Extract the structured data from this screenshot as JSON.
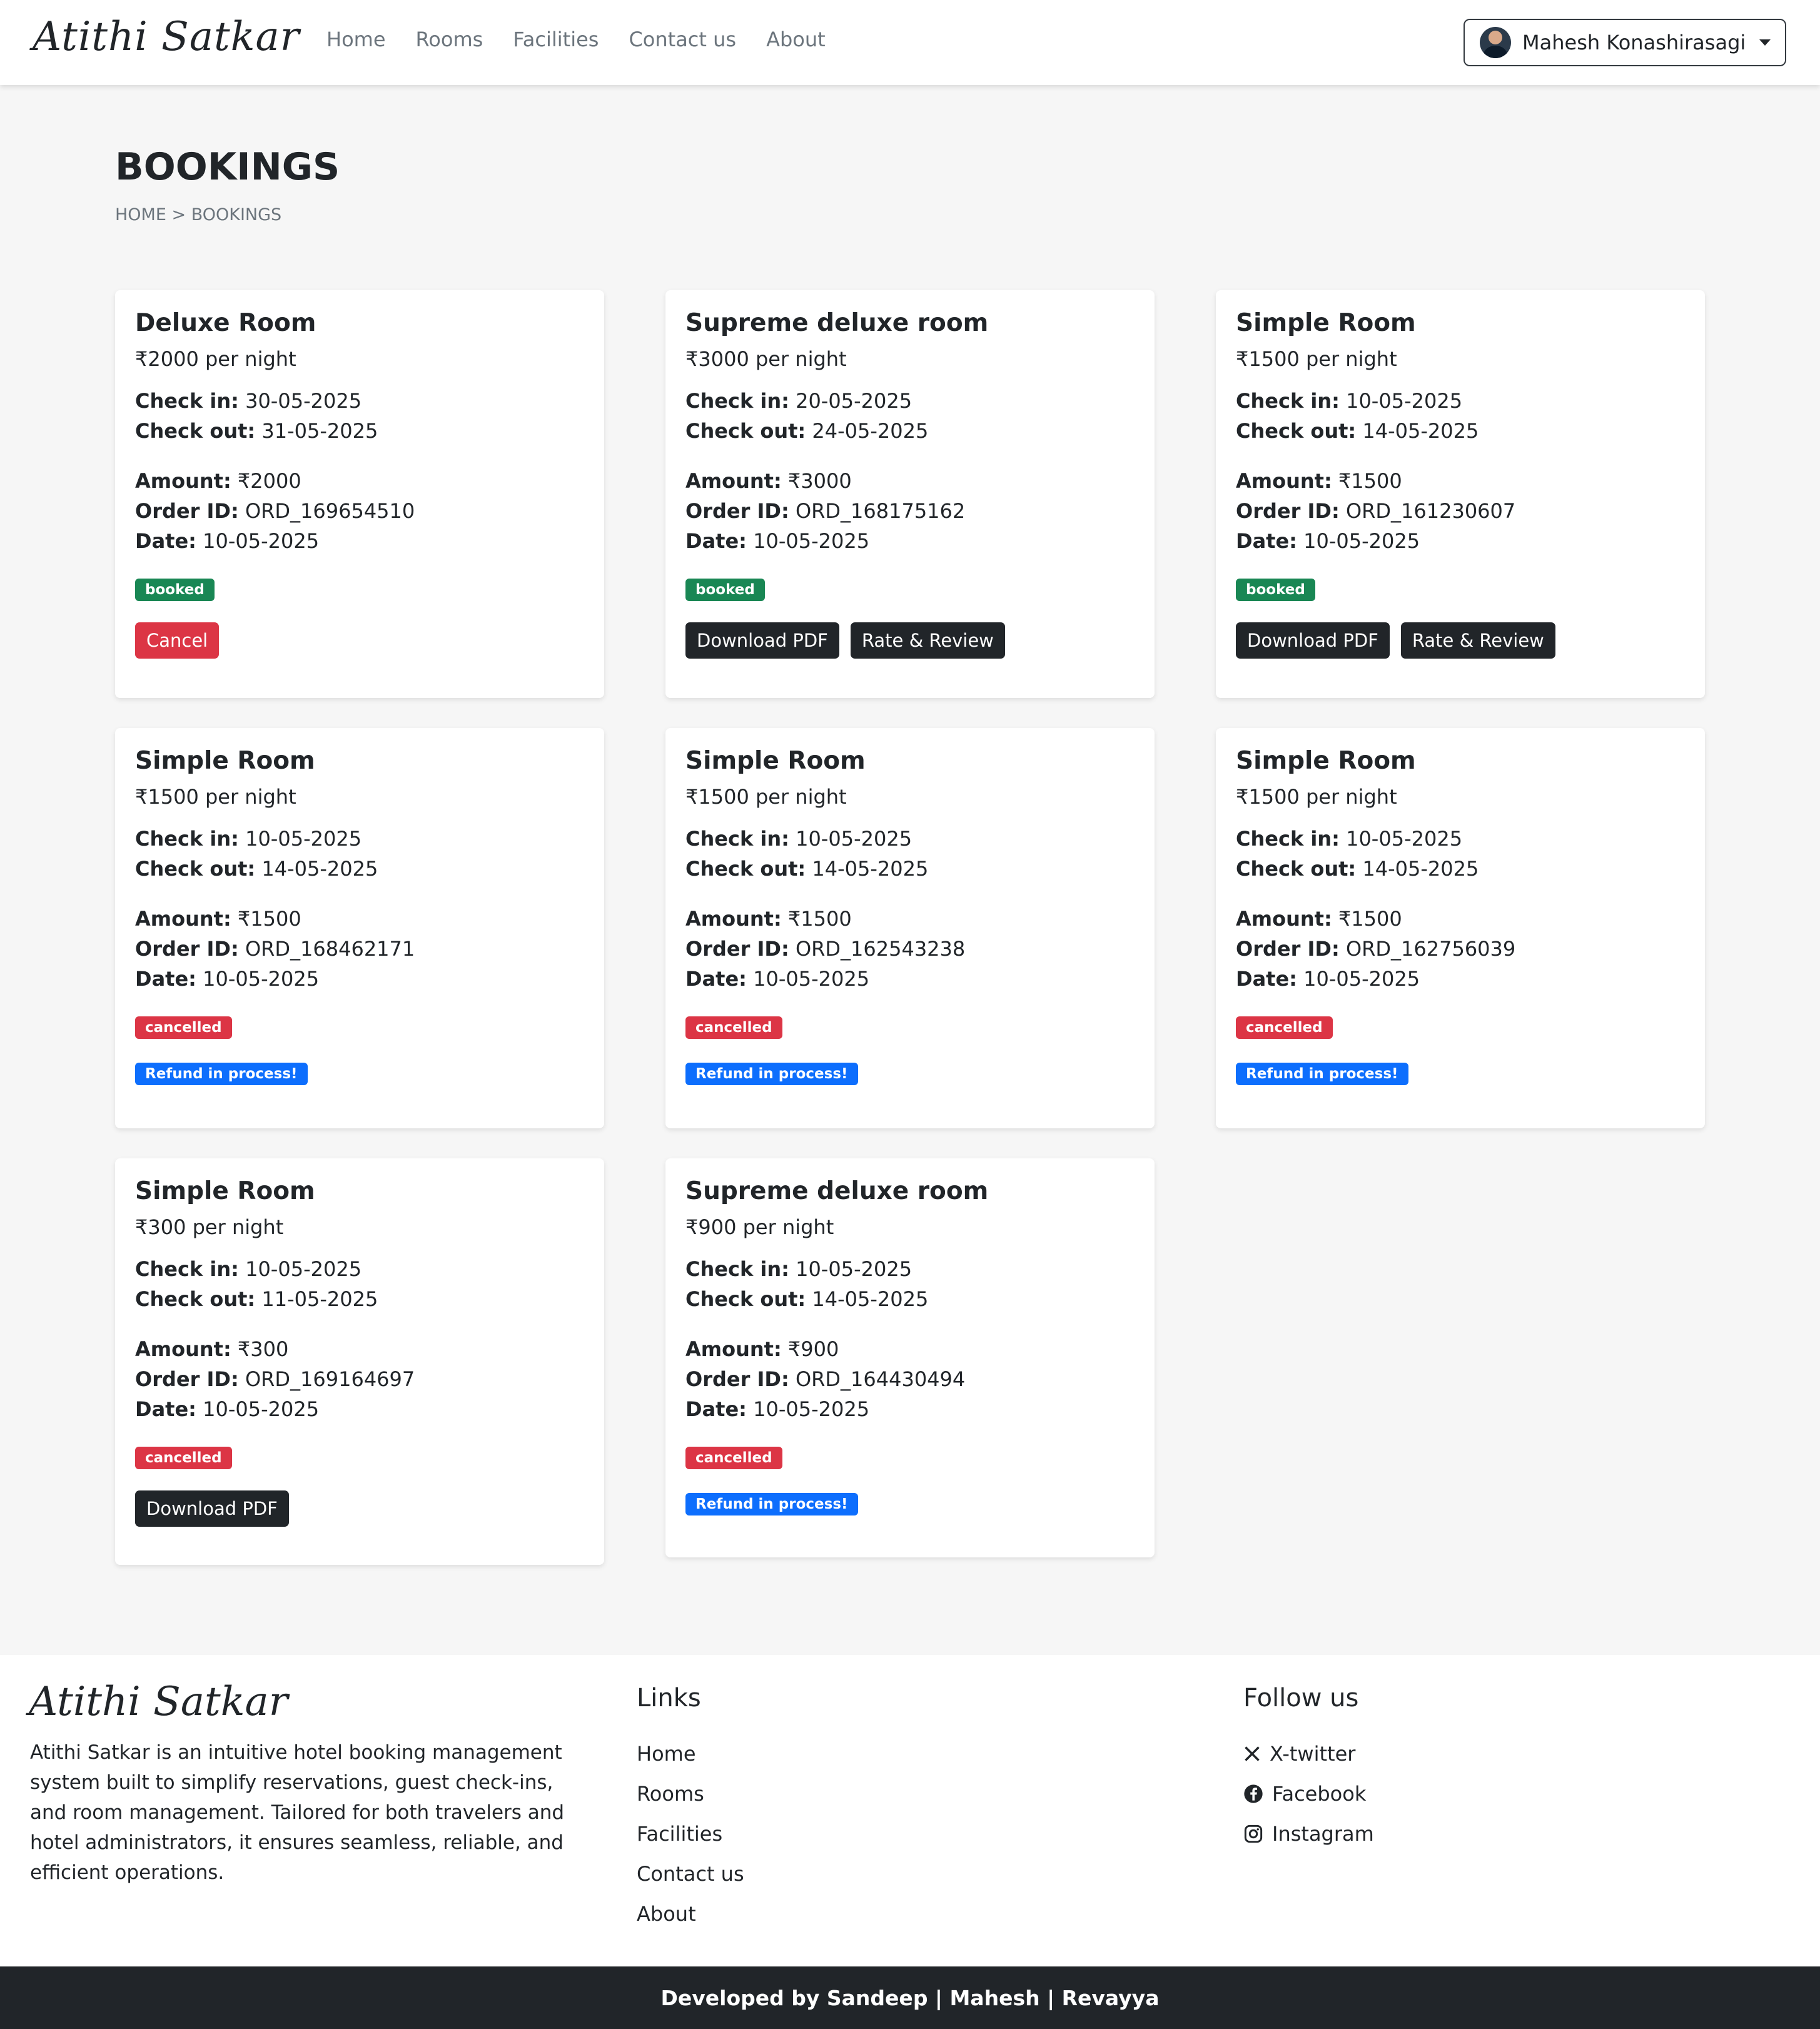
{
  "navbar": {
    "brand": "Atithi Satkar",
    "links": [
      "Home",
      "Rooms",
      "Facilities",
      "Contact us",
      "About"
    ],
    "user": "Mahesh Konashirasagi"
  },
  "header": {
    "title": "BOOKINGS",
    "breadcrumb": "HOME > BOOKINGS"
  },
  "labels": {
    "check_in": "Check in:",
    "check_out": "Check out:",
    "amount": "Amount:",
    "order_id": "Order ID:",
    "date": "Date:"
  },
  "bookings": [
    {
      "room": "Deluxe Room",
      "price": "₹2000 per night",
      "check_in": "30-05-2025",
      "check_out": "31-05-2025",
      "amount": "₹2000",
      "order_id": "ORD_169654510",
      "date": "10-05-2025",
      "status": "booked",
      "actions": [
        "Cancel"
      ]
    },
    {
      "room": "Supreme deluxe room",
      "price": "₹3000 per night",
      "check_in": "20-05-2025",
      "check_out": "24-05-2025",
      "amount": "₹3000",
      "order_id": "ORD_168175162",
      "date": "10-05-2025",
      "status": "booked",
      "actions": [
        "Download PDF",
        "Rate & Review"
      ]
    },
    {
      "room": "Simple Room",
      "price": "₹1500 per night",
      "check_in": "10-05-2025",
      "check_out": "14-05-2025",
      "amount": "₹1500",
      "order_id": "ORD_161230607",
      "date": "10-05-2025",
      "status": "booked",
      "actions": [
        "Download PDF",
        "Rate & Review"
      ]
    },
    {
      "room": "Simple Room",
      "price": "₹1500 per night",
      "check_in": "10-05-2025",
      "check_out": "14-05-2025",
      "amount": "₹1500",
      "order_id": "ORD_168462171",
      "date": "10-05-2025",
      "status": "cancelled",
      "refund": "Refund in process!"
    },
    {
      "room": "Simple Room",
      "price": "₹1500 per night",
      "check_in": "10-05-2025",
      "check_out": "14-05-2025",
      "amount": "₹1500",
      "order_id": "ORD_162543238",
      "date": "10-05-2025",
      "status": "cancelled",
      "refund": "Refund in process!"
    },
    {
      "room": "Simple Room",
      "price": "₹1500 per night",
      "check_in": "10-05-2025",
      "check_out": "14-05-2025",
      "amount": "₹1500",
      "order_id": "ORD_162756039",
      "date": "10-05-2025",
      "status": "cancelled",
      "refund": "Refund in process!"
    },
    {
      "room": "Simple Room",
      "price": "₹300 per night",
      "check_in": "10-05-2025",
      "check_out": "11-05-2025",
      "amount": "₹300",
      "order_id": "ORD_169164697",
      "date": "10-05-2025",
      "status": "cancelled",
      "actions": [
        "Download PDF"
      ]
    },
    {
      "room": "Supreme deluxe room",
      "price": "₹900 per night",
      "check_in": "10-05-2025",
      "check_out": "14-05-2025",
      "amount": "₹900",
      "order_id": "ORD_164430494",
      "date": "10-05-2025",
      "status": "cancelled",
      "refund": "Refund in process!"
    }
  ],
  "footer": {
    "brand": "Atithi Satkar",
    "description": "Atithi Satkar is an intuitive hotel booking management system built to simplify reservations, guest check-ins, and room management. Tailored for both travelers and hotel administrators, it ensures seamless, reliable, and efficient operations.",
    "links_heading": "Links",
    "links": [
      "Home",
      "Rooms",
      "Facilities",
      "Contact us",
      "About"
    ],
    "follow_heading": "Follow us",
    "social": [
      {
        "label": "X-twitter",
        "icon": "x-twitter-icon"
      },
      {
        "label": "Facebook",
        "icon": "facebook-icon"
      },
      {
        "label": "Instagram",
        "icon": "instagram-icon"
      }
    ],
    "credits": "Developed by Sandeep | Mahesh | Revayya"
  },
  "colors": {
    "booked": "#198754",
    "cancelled": "#dc3545",
    "refund": "#0d6efd",
    "dark_button": "#212529",
    "cancel_button": "#dc3545"
  }
}
